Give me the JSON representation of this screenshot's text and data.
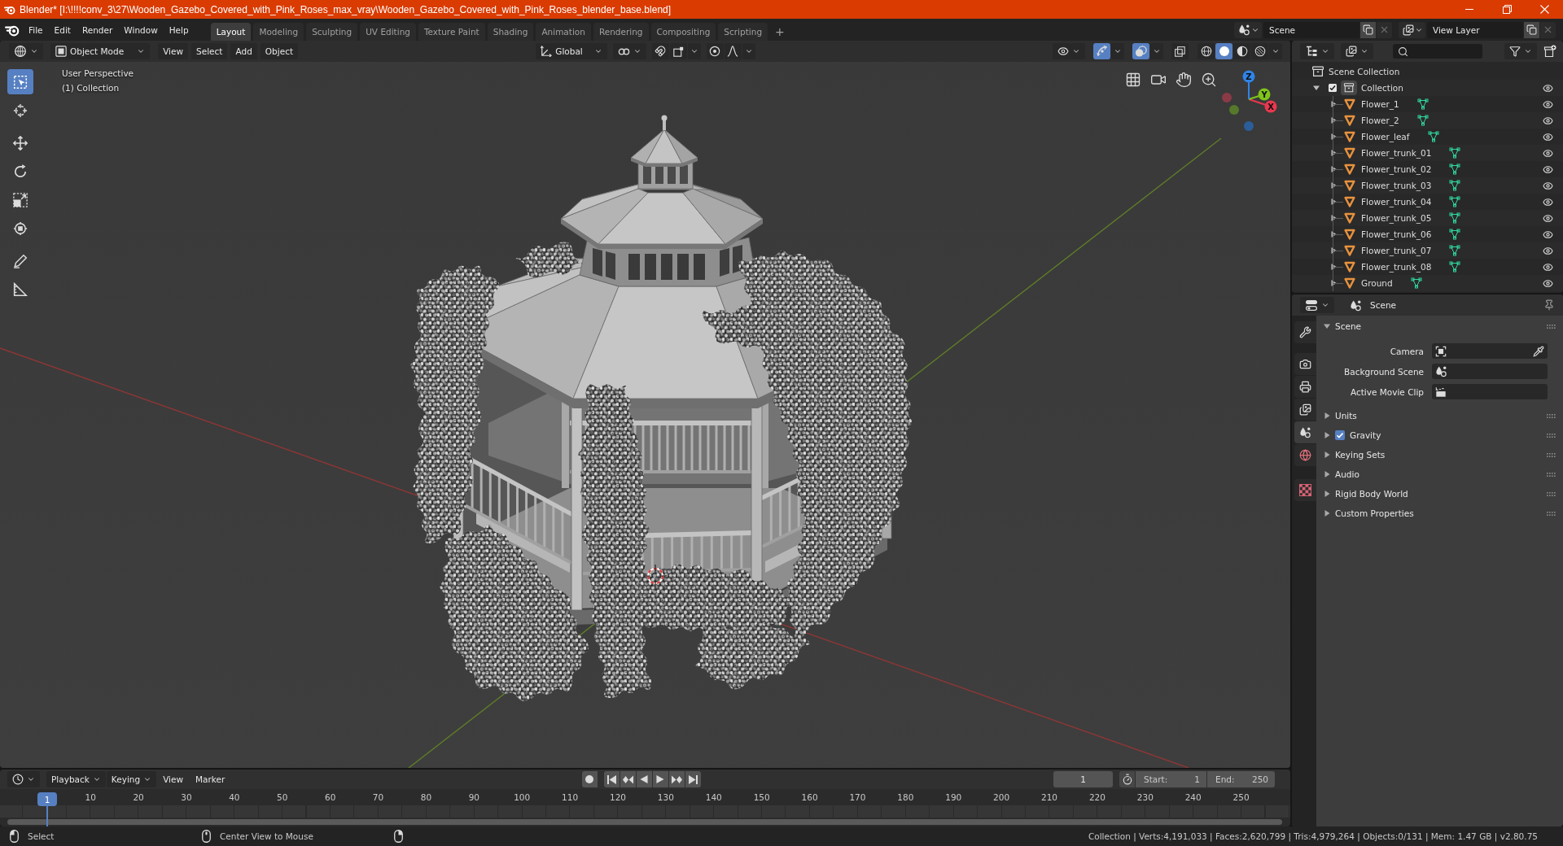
{
  "title_bar": {
    "title": "Blender* [I:\\!!!!conv_3\\27\\Wooden_Gazebo_Covered_with_Pink_Roses_max_vray\\Wooden_Gazebo_Covered_with_Pink_Roses_blender_base.blend]"
  },
  "top_bar": {
    "menus": [
      "File",
      "Edit",
      "Render",
      "Window",
      "Help"
    ],
    "workspaces": [
      {
        "label": "Layout",
        "selected": true
      },
      {
        "label": "Modeling",
        "selected": false
      },
      {
        "label": "Sculpting",
        "selected": false
      },
      {
        "label": "UV Editing",
        "selected": false
      },
      {
        "label": "Texture Paint",
        "selected": false
      },
      {
        "label": "Shading",
        "selected": false
      },
      {
        "label": "Animation",
        "selected": false
      },
      {
        "label": "Rendering",
        "selected": false
      },
      {
        "label": "Compositing",
        "selected": false
      },
      {
        "label": "Scripting",
        "selected": false
      }
    ],
    "add_workspace": "+",
    "scene": "Scene",
    "view_layer": "View Layer"
  },
  "viewport": {
    "header": {
      "mode": "Object Mode",
      "menus": [
        "View",
        "Select",
        "Add",
        "Object"
      ],
      "orientation": "Global",
      "snap": false,
      "proportional_editing": false,
      "show_gizmo": true,
      "show_overlays": true,
      "xray": false,
      "shading": [
        {
          "kind": "wireframe",
          "selected": false
        },
        {
          "kind": "solid",
          "selected": true
        },
        {
          "kind": "material",
          "selected": false
        },
        {
          "kind": "rendered",
          "selected": false
        }
      ]
    },
    "tool_groups": [
      [
        {
          "kind": "select_box",
          "selected": true
        },
        {
          "kind": "cursor",
          "selected": false
        }
      ],
      [
        {
          "kind": "move",
          "selected": false
        },
        {
          "kind": "rotate",
          "selected": false
        },
        {
          "kind": "scale",
          "selected": false
        },
        {
          "kind": "transform",
          "selected": false
        }
      ],
      [
        {
          "kind": "annotate",
          "selected": false
        },
        {
          "kind": "measure",
          "selected": false
        }
      ]
    ],
    "view_name": "User Perspective",
    "collection_label": "(1) Collection",
    "gizmo_axes": [
      "X",
      "Y",
      "Z"
    ]
  },
  "outliner": {
    "root": "Scene Collection",
    "collections": [
      {
        "name": "Collection",
        "checked": true,
        "expanded": true,
        "children": [
          {
            "name": "Flower_1",
            "expanded": false
          },
          {
            "name": "Flower_2",
            "expanded": false
          },
          {
            "name": "Flower_leaf",
            "expanded": false
          },
          {
            "name": "Flower_trunk_01",
            "expanded": false
          },
          {
            "name": "Flower_trunk_02",
            "expanded": false
          },
          {
            "name": "Flower_trunk_03",
            "expanded": false
          },
          {
            "name": "Flower_trunk_04",
            "expanded": false
          },
          {
            "name": "Flower_trunk_05",
            "expanded": false
          },
          {
            "name": "Flower_trunk_06",
            "expanded": false
          },
          {
            "name": "Flower_trunk_07",
            "expanded": false
          },
          {
            "name": "Flower_trunk_08",
            "expanded": false
          },
          {
            "name": "Ground",
            "expanded": false
          }
        ]
      }
    ]
  },
  "properties": {
    "context": "Scene",
    "tab_groups": [
      [
        {
          "kind": "tool",
          "selected": false
        }
      ],
      [
        {
          "kind": "render",
          "selected": false
        },
        {
          "kind": "output",
          "selected": false
        },
        {
          "kind": "view_layer",
          "selected": false
        },
        {
          "kind": "scene",
          "selected": true
        },
        {
          "kind": "world",
          "selected": false
        }
      ],
      [
        {
          "kind": "texture",
          "selected": false
        }
      ]
    ],
    "panels": [
      {
        "title": "Scene",
        "kind": "plain",
        "expanded": true,
        "fields": [
          {
            "label": "Camera",
            "kind": "camera"
          },
          {
            "label": "Background Scene",
            "kind": "scene"
          },
          {
            "label": "Active Movie Clip",
            "kind": "clip"
          }
        ]
      },
      {
        "title": "Units",
        "kind": "plain",
        "expanded": false
      },
      {
        "title": "Gravity",
        "kind": "toggle",
        "checked": true,
        "expanded": false
      },
      {
        "title": "Keying Sets",
        "kind": "plain",
        "expanded": false
      },
      {
        "title": "Audio",
        "kind": "plain",
        "expanded": false
      },
      {
        "title": "Rigid Body World",
        "kind": "plain",
        "expanded": false
      },
      {
        "title": "Custom Properties",
        "kind": "plain",
        "expanded": false
      }
    ]
  },
  "timeline": {
    "menus": [
      {
        "label": "Playback",
        "kind": "dropdown"
      },
      {
        "label": "Keying",
        "kind": "dropdown"
      },
      {
        "label": "View",
        "kind": "menu"
      },
      {
        "label": "Marker",
        "kind": "menu"
      }
    ],
    "current_frame": "1",
    "start_label": "Start:",
    "start": "1",
    "end_label": "End:",
    "end": "250",
    "playhead": "1",
    "ruler": [
      "10",
      "20",
      "30",
      "40",
      "50",
      "60",
      "70",
      "80",
      "90",
      "100",
      "110",
      "120",
      "130",
      "140",
      "150",
      "160",
      "170",
      "180",
      "190",
      "200",
      "210",
      "220",
      "230",
      "240",
      "250"
    ]
  },
  "status_bar": {
    "hints": [
      "Select",
      "Center View to Mouse"
    ],
    "stats": "Collection | Verts:4,191,033 | Faces:2,620,799 | Tris:4,979,264 | Objects:0/131 | Mem: 1.47 GB | v2.80.75"
  }
}
